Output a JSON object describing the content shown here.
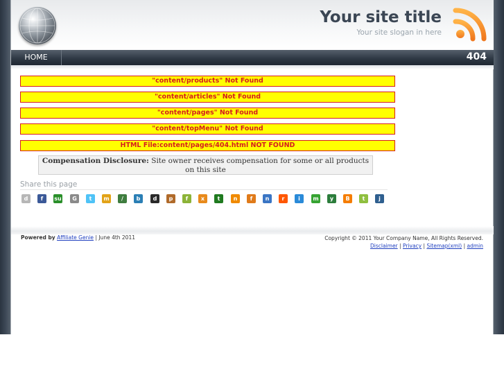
{
  "header": {
    "title": "Your site title",
    "slogan": "Your site slogan in here"
  },
  "nav": {
    "home": "HOME",
    "page_code": "404"
  },
  "errors": [
    "\"content/products\" Not Found",
    "\"content/articles\" Not Found",
    "\"content/pages\" Not Found",
    "\"content/topMenu\" Not Found",
    "HTML File:content/pages/404.html NOT FOUND"
  ],
  "disclosure": {
    "label": "Compensation Disclosure:",
    "text": "Site owner receives compensation for some or all products on this site"
  },
  "share": {
    "label": "Share this page",
    "icons": [
      {
        "name": "digg-icon",
        "glyph": "d",
        "color": "#b7b7b7"
      },
      {
        "name": "facebook-icon",
        "glyph": "f",
        "color": "#3b5998"
      },
      {
        "name": "stumbleupon-icon",
        "glyph": "su",
        "color": "#2a8f2a"
      },
      {
        "name": "google-icon",
        "glyph": "G",
        "color": "#8a8a8a"
      },
      {
        "name": "twitter-icon",
        "glyph": "t",
        "color": "#4fc3f7"
      },
      {
        "name": "myspace-icon",
        "glyph": "m",
        "color": "#e2a318"
      },
      {
        "name": "slashdot-icon",
        "glyph": "/",
        "color": "#3f7d3f"
      },
      {
        "name": "blinklist-icon",
        "glyph": "b",
        "color": "#2b7fb5"
      },
      {
        "name": "delicious-icon",
        "glyph": "d",
        "color": "#2a2a2a"
      },
      {
        "name": "propeller-icon",
        "glyph": "p",
        "color": "#b06a2a"
      },
      {
        "name": "furl-icon",
        "glyph": "f",
        "color": "#8cb338"
      },
      {
        "name": "mixx-icon",
        "glyph": "x",
        "color": "#e88a1c"
      },
      {
        "name": "technorati-icon",
        "glyph": "t",
        "color": "#1f7a1f"
      },
      {
        "name": "netvibes-icon",
        "glyph": "n",
        "color": "#f08a00"
      },
      {
        "name": "fark-icon",
        "glyph": "f",
        "color": "#e07b1a"
      },
      {
        "name": "newsvine-icon",
        "glyph": "n",
        "color": "#3a75c4"
      },
      {
        "name": "reddit-icon",
        "glyph": "r",
        "color": "#ff5700"
      },
      {
        "name": "linkarena-icon",
        "glyph": "i",
        "color": "#2a8ad8"
      },
      {
        "name": "magnolia-icon",
        "glyph": "m",
        "color": "#36a332"
      },
      {
        "name": "yigg-icon",
        "glyph": "y",
        "color": "#2c7d3c"
      },
      {
        "name": "blogger-icon",
        "glyph": "B",
        "color": "#f57d00"
      },
      {
        "name": "tipd-icon",
        "glyph": "t",
        "color": "#8fbf3f"
      },
      {
        "name": "jumptags-icon",
        "glyph": "j",
        "color": "#2f5f8f"
      }
    ]
  },
  "footer": {
    "powered_prefix": "Powered by",
    "powered_link": "Affiliate Genie",
    "powered_suffix": "| June 4th 2011",
    "copyright": "Copyright © 2011 Your Company Name, All Rights Reserved.",
    "links": [
      "Disclaimer",
      "Privacy",
      "Sitemap(xml)",
      "admin"
    ],
    "separator": "|"
  }
}
